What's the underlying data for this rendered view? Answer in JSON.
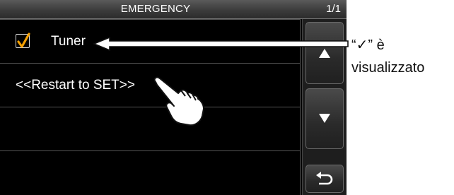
{
  "header": {
    "title": "EMERGENCY",
    "page_indicator": "1/1"
  },
  "list": {
    "items": [
      {
        "label": "Tuner",
        "checked": true,
        "check_color": "#f5a000"
      },
      {
        "label": "<<Restart to SET>>"
      },
      {
        "label": ""
      },
      {
        "label": ""
      }
    ]
  },
  "scroll": {
    "up_icon": "triangle-up-icon",
    "down_icon": "triangle-down-icon",
    "back_icon": "return-arrow-icon"
  },
  "annotation": {
    "line1": "“✓” è",
    "line2": "visualizzato"
  },
  "icons": {
    "hand": "pointing-hand-icon",
    "pointer_arrow": "callout-arrow-icon"
  }
}
